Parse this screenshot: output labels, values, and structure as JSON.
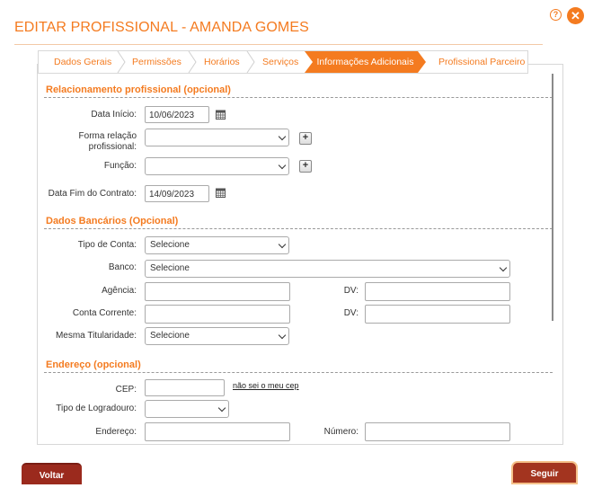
{
  "header": {
    "title": "EDITAR PROFISSIONAL - AMANDA GOMES",
    "help_icon": "question-circle-icon",
    "close_icon": "close-x-icon"
  },
  "tabs": [
    {
      "label": "Dados Gerais",
      "active": false
    },
    {
      "label": "Permissões",
      "active": false
    },
    {
      "label": "Horários",
      "active": false
    },
    {
      "label": "Serviços",
      "active": false
    },
    {
      "label": "Informações Adicionais",
      "active": true
    },
    {
      "label": "Profissional Parceiro",
      "active": false
    }
  ],
  "relacionamento": {
    "heading": "Relacionamento profissional (opcional)",
    "data_inicio_label": "Data Início:",
    "data_inicio_value": "10/06/2023",
    "forma_relacao_label": "Forma relação profissional:",
    "forma_relacao_label_l1": "Forma relação",
    "forma_relacao_label_l2": "profissional:",
    "forma_relacao_value": "",
    "funcao_label": "Função:",
    "funcao_value": "",
    "data_fim_label": "Data Fim do Contrato:",
    "data_fim_value": "14/09/2023"
  },
  "bancarios": {
    "heading": "Dados Bancários (Opcional)",
    "tipo_conta_label": "Tipo de Conta:",
    "tipo_conta_value": "Selecione",
    "banco_label": "Banco:",
    "banco_value": "Selecione",
    "agencia_label": "Agência:",
    "agencia_value": "",
    "agencia_dv_label": "DV:",
    "conta_label": "Conta Corrente:",
    "conta_value": "",
    "conta_dv_label": "DV:",
    "titularidade_label": "Mesma Titularidade:",
    "titularidade_value": "Selecione"
  },
  "endereco": {
    "heading": "Endereço (opcional)",
    "cep_label": "CEP:",
    "cep_value": "",
    "cep_link": "não sei o meu cep",
    "logradouro_label": "Tipo de Logradouro:",
    "logradouro_value": "",
    "endereco_label": "Endereço:",
    "endereco_value": "",
    "numero_label": "Número:",
    "numero_value": ""
  },
  "footer": {
    "back_label": "Voltar",
    "next_label": "Seguir"
  },
  "colors": {
    "accent": "#f47b20",
    "back_button": "#9b2a1d"
  }
}
